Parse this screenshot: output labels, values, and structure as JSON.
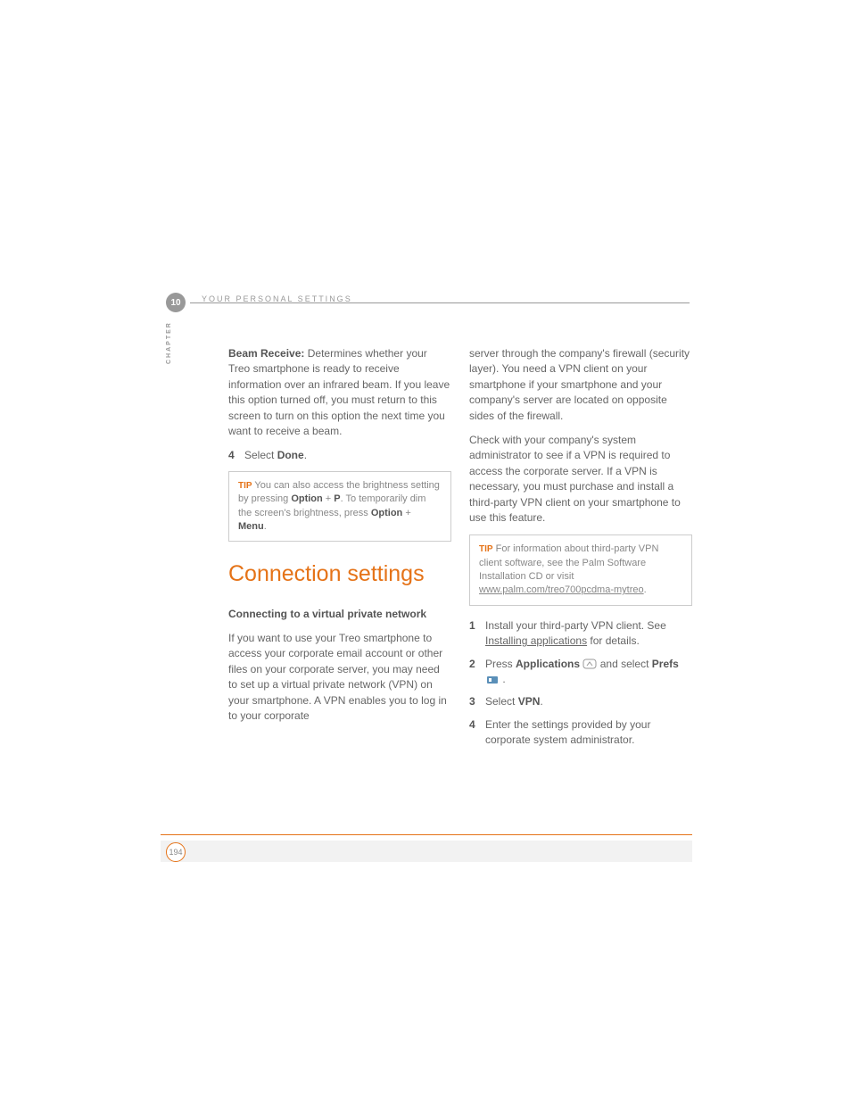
{
  "header": {
    "chapter_number": "10",
    "chapter_label": "CHAPTER",
    "title": "YOUR PERSONAL SETTINGS"
  },
  "left_col": {
    "beam_receive_label": "Beam Receive:",
    "beam_receive_text": " Determines whether your Treo smartphone is ready to receive information over an infrared beam. If you leave this option turned off, you must return to this screen to turn on this option the next time you want to receive a beam.",
    "step4_num": "4",
    "step4_pre": "Select ",
    "step4_bold": "Done",
    "step4_post": ".",
    "tip_label": "TIP",
    "tip_pre": " You can also access the brightness setting by pressing ",
    "tip_b1": "Option",
    "tip_mid1": " + ",
    "tip_b2": "P",
    "tip_mid2": ". To temporarily dim the screen's brightness, press ",
    "tip_b3": "Option",
    "tip_mid3": " + ",
    "tip_b4": "Menu",
    "tip_post": ".",
    "section_heading": "Connection settings",
    "subheading": "Connecting to a virtual private network",
    "vpn_intro": "If you want to use your Treo smartphone to access your corporate email account or other files on your corporate server, you may need to set up a virtual private network (VPN) on your smartphone. A VPN enables you to log in to your corporate"
  },
  "right_col": {
    "vpn_cont": "server through the company's firewall (security layer). You need a VPN client on your smartphone if your smartphone and your company's server are located on opposite sides of the firewall.",
    "vpn_check": "Check with your company's system administrator to see if a VPN is required to access the corporate server. If a VPN is necessary, you must purchase and install a third-party VPN client on your smartphone to use this feature.",
    "tip_label": "TIP",
    "tip_pre": " For information about third-party VPN client software, see the Palm Software Installation CD or visit ",
    "tip_link": "www.palm.com/treo700pcdma-mytreo",
    "tip_post": ".",
    "s1_num": "1",
    "s1_pre": "Install your third-party VPN client. See ",
    "s1_link": "Installing applications",
    "s1_post": " for details.",
    "s2_num": "2",
    "s2_pre": "Press ",
    "s2_b1": "Applications",
    "s2_mid": " and select ",
    "s2_b2": "Prefs",
    "s2_post": " .",
    "s3_num": "3",
    "s3_pre": "Select ",
    "s3_b1": "VPN",
    "s3_post": ".",
    "s4_num": "4",
    "s4_text": "Enter the settings provided by your corporate system administrator."
  },
  "footer": {
    "page_number": "194"
  }
}
